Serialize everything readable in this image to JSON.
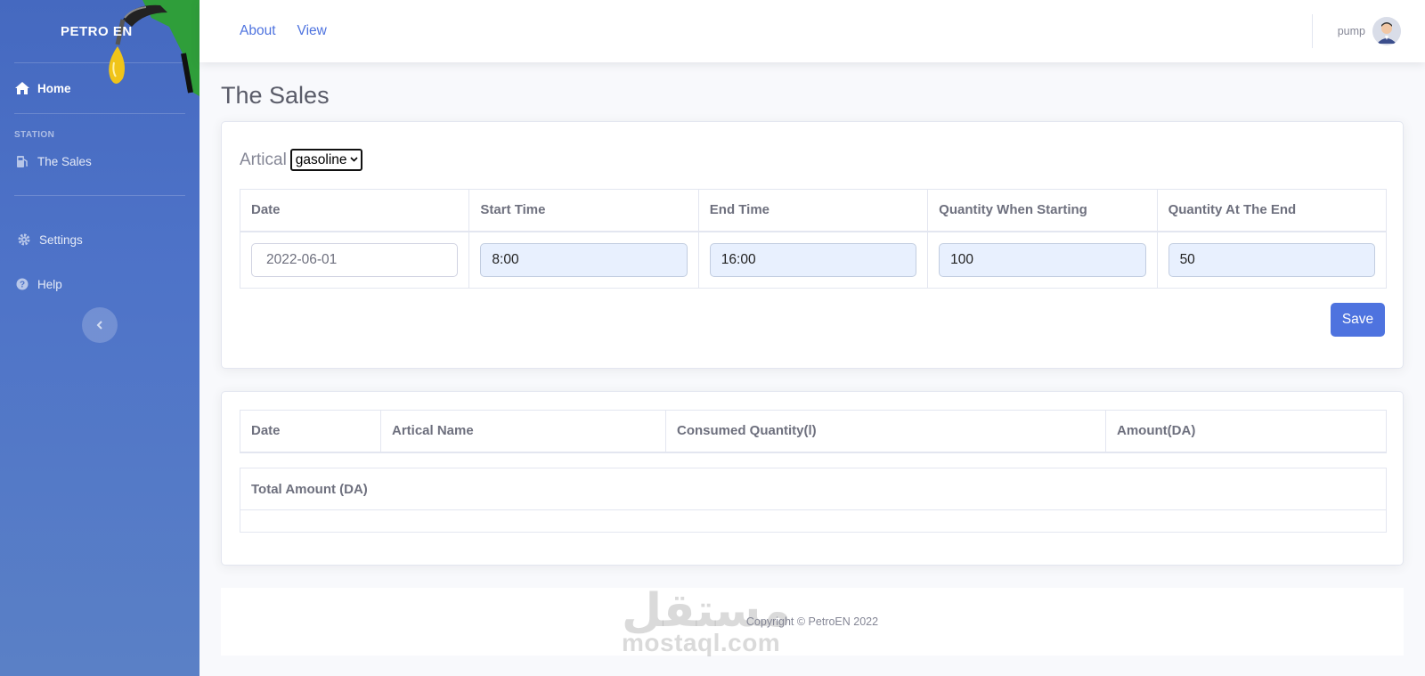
{
  "sidebar": {
    "brand": "PETRO EN",
    "home": "Home",
    "section_heading": "STATION",
    "sales": "The Sales",
    "settings": "Settings",
    "help": "Help"
  },
  "topbar": {
    "links": [
      "About",
      "View"
    ],
    "user": "pump"
  },
  "main": {
    "title": "The Sales",
    "artical_label": "Artical",
    "artical_selected": "gasoline",
    "entry_table": {
      "headers": [
        "Date",
        "Start Time",
        "End Time",
        "Quantity When Starting",
        "Quantity At The End"
      ],
      "values": {
        "date_placeholder": "2022-06-01",
        "start_time": "8:00",
        "end_time": "16:00",
        "qty_start": "100",
        "qty_end": "50"
      }
    },
    "save_label": "Save",
    "sales_table": {
      "headers": [
        "Date",
        "Artical Name",
        "Consumed Quantity(l)",
        "Amount(DA)"
      ]
    },
    "total_label": "Total Amount (DA)"
  },
  "footer": {
    "copyright": "Copyright © PetroEN 2022"
  },
  "watermark": {
    "arabic": "مستقل",
    "latin": "mostaql.com"
  },
  "colors": {
    "primary": "#4e73df",
    "sidebar_top": "#4569c0",
    "input_filled": "#e8f0fe"
  }
}
